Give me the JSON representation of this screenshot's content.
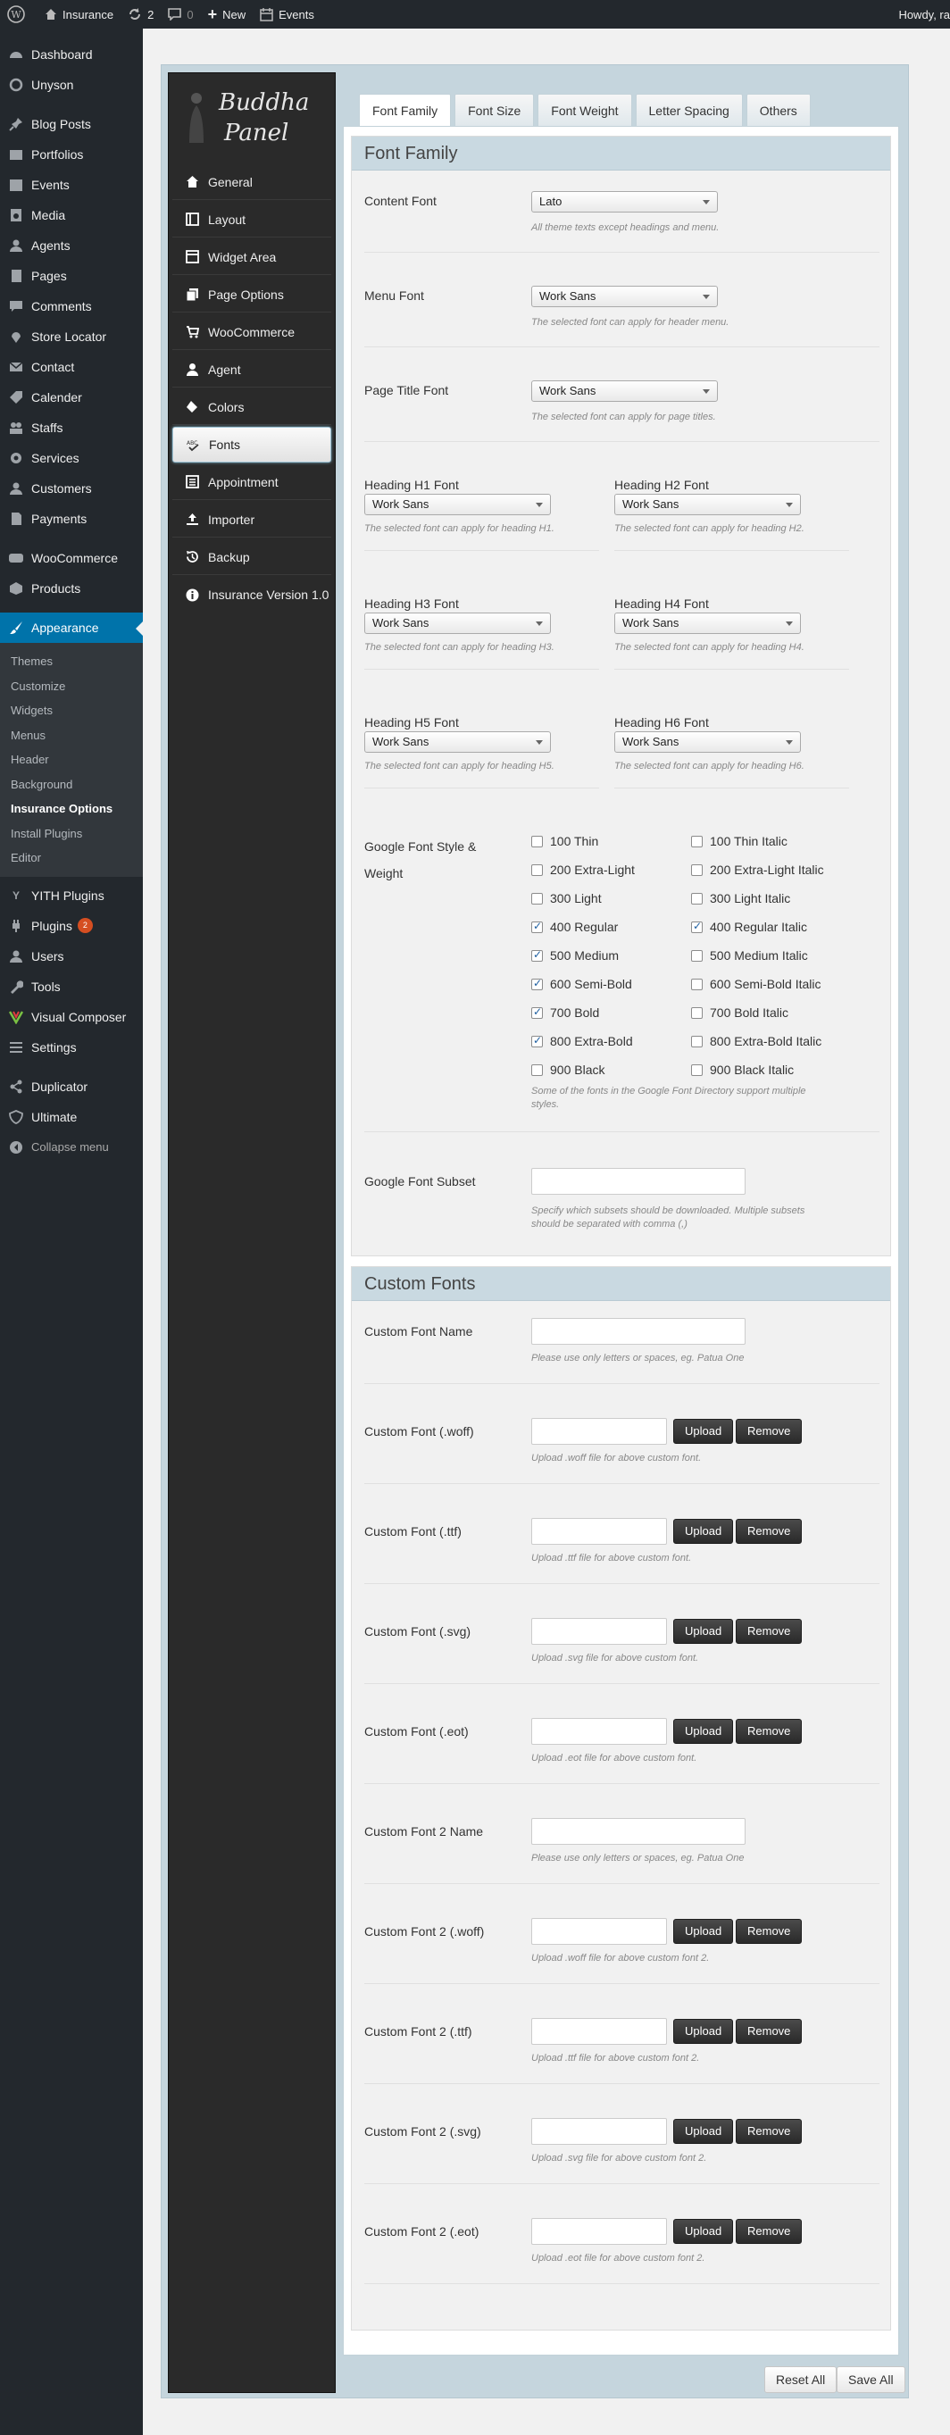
{
  "adminbar": {
    "site_name": "Insurance",
    "updates": "2",
    "comments": "0",
    "new_label": "New",
    "events_label": "Events",
    "howdy": "Howdy, ra"
  },
  "sidebar": {
    "group1": [
      "Dashboard",
      "Unyson"
    ],
    "group2": [
      "Blog Posts",
      "Portfolios",
      "Events",
      "Media",
      "Agents",
      "Pages",
      "Comments",
      "Store Locator",
      "Contact",
      "Calender",
      "Staffs",
      "Services",
      "Customers",
      "Payments"
    ],
    "group3": [
      "WooCommerce",
      "Products"
    ],
    "appearance": "Appearance",
    "appearance_sub": [
      "Themes",
      "Customize",
      "Widgets",
      "Menus",
      "Header",
      "Background",
      "Insurance Options",
      "Install Plugins",
      "Editor"
    ],
    "group4": [
      "YITH Plugins",
      "Plugins",
      "Users",
      "Tools",
      "Visual Composer",
      "Settings"
    ],
    "plugins_badge": "2",
    "group5": [
      "Duplicator",
      "Ultimate"
    ],
    "collapse": "Collapse menu"
  },
  "panel": {
    "logo_line1": "Buddha",
    "logo_line2": "Panel",
    "nav": [
      "General",
      "Layout",
      "Widget Area",
      "Page Options",
      "WooCommerce",
      "Agent",
      "Colors",
      "Fonts",
      "Appointment",
      "Importer",
      "Backup",
      "Insurance Version 1.0"
    ]
  },
  "tabs": [
    "Font Family",
    "Font Size",
    "Font Weight",
    "Letter Spacing",
    "Others"
  ],
  "font_family": {
    "title": "Font Family",
    "content_font": {
      "label": "Content Font",
      "value": "Lato",
      "hint": "All theme texts except headings and menu."
    },
    "menu_font": {
      "label": "Menu Font",
      "value": "Work Sans",
      "hint": "The selected font can apply for header menu."
    },
    "page_title_font": {
      "label": "Page Title Font",
      "value": "Work Sans",
      "hint": "The selected font can apply for page titles."
    },
    "h1": {
      "label": "Heading H1 Font",
      "value": "Work Sans",
      "hint": "The selected font can apply for heading H1."
    },
    "h2": {
      "label": "Heading H2 Font",
      "value": "Work Sans",
      "hint": "The selected font can apply for heading H2."
    },
    "h3": {
      "label": "Heading H3 Font",
      "value": "Work Sans",
      "hint": "The selected font can apply for heading H3."
    },
    "h4": {
      "label": "Heading H4 Font",
      "value": "Work Sans",
      "hint": "The selected font can apply for heading H4."
    },
    "h5": {
      "label": "Heading H5 Font",
      "value": "Work Sans",
      "hint": "The selected font can apply for heading H5."
    },
    "h6": {
      "label": "Heading H6 Font",
      "value": "Work Sans",
      "hint": "The selected font can apply for heading H6."
    },
    "style_weight": {
      "label_line1": "Google Font Style &",
      "label_line2": "Weight",
      "options_left": [
        {
          "label": "100 Thin",
          "checked": false
        },
        {
          "label": "200 Extra-Light",
          "checked": false
        },
        {
          "label": "300 Light",
          "checked": false
        },
        {
          "label": "400 Regular",
          "checked": true
        },
        {
          "label": "500 Medium",
          "checked": true
        },
        {
          "label": "600 Semi-Bold",
          "checked": true
        },
        {
          "label": "700 Bold",
          "checked": true
        },
        {
          "label": "800 Extra-Bold",
          "checked": true
        },
        {
          "label": "900 Black",
          "checked": false
        }
      ],
      "options_right": [
        {
          "label": "100 Thin Italic",
          "checked": false
        },
        {
          "label": "200 Extra-Light Italic",
          "checked": false
        },
        {
          "label": "300 Light Italic",
          "checked": false
        },
        {
          "label": "400 Regular Italic",
          "checked": true
        },
        {
          "label": "500 Medium Italic",
          "checked": false
        },
        {
          "label": "600 Semi-Bold Italic",
          "checked": false
        },
        {
          "label": "700 Bold Italic",
          "checked": false
        },
        {
          "label": "800 Extra-Bold Italic",
          "checked": false
        },
        {
          "label": "900 Black Italic",
          "checked": false
        }
      ],
      "hint_line1": "Some of the fonts in the Google Font Directory support multiple",
      "hint_line2": "styles."
    },
    "subset": {
      "label": "Google Font Subset",
      "value": "",
      "hint_line1": "Specify which subsets should be downloaded. Multiple subsets",
      "hint_line2": "should be separated with comma (,)"
    }
  },
  "custom_fonts": {
    "title": "Custom Fonts",
    "upload_label": "Upload",
    "remove_label": "Remove",
    "name1": {
      "label": "Custom Font Name",
      "hint": "Please use only letters or spaces, eg. Patua One"
    },
    "files1": [
      {
        "label": "Custom Font (.woff)",
        "hint": "Upload .woff file for above custom font."
      },
      {
        "label": "Custom Font (.ttf)",
        "hint": "Upload .ttf file for above custom font."
      },
      {
        "label": "Custom Font (.svg)",
        "hint": "Upload .svg file for above custom font."
      },
      {
        "label": "Custom Font (.eot)",
        "hint": "Upload .eot file for above custom font."
      }
    ],
    "name2": {
      "label": "Custom Font 2 Name",
      "hint": "Please use only letters or spaces, eg. Patua One"
    },
    "files2": [
      {
        "label": "Custom Font 2 (.woff)",
        "hint": "Upload .woff file for above custom font 2."
      },
      {
        "label": "Custom Font 2 (.ttf)",
        "hint": "Upload .ttf file for above custom font 2."
      },
      {
        "label": "Custom Font 2 (.svg)",
        "hint": "Upload .svg file for above custom font 2."
      },
      {
        "label": "Custom Font 2 (.eot)",
        "hint": "Upload .eot file for above custom font 2."
      }
    ]
  },
  "footer": {
    "reset_label": "Reset All",
    "save_label": "Save All"
  },
  "colors": {
    "admin_dark": "#23282d",
    "accent": "#0073aa",
    "panel_bg": "#c5d5dd",
    "badge": "#d54e21"
  }
}
